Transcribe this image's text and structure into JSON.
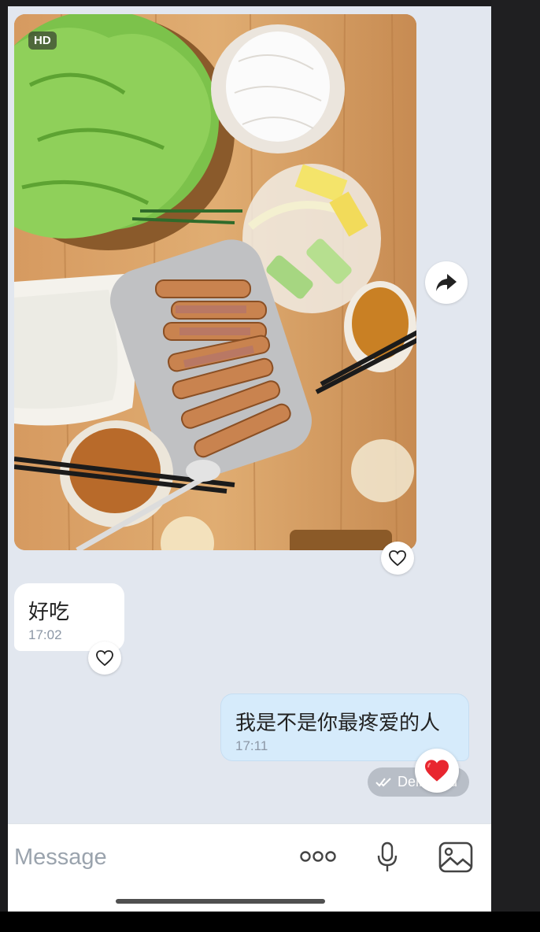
{
  "photo": {
    "badge": "HD",
    "liked": false
  },
  "messages": [
    {
      "direction": "incoming",
      "text": "好吃",
      "time": "17:02",
      "liked": false
    },
    {
      "direction": "outgoing",
      "text": "我是不是你最疼爱的人",
      "time": "17:11",
      "reaction": "heart",
      "status": "Delivered"
    }
  ],
  "composer": {
    "placeholder": "Message",
    "icons": [
      "more-icon",
      "microphone-icon",
      "image-icon"
    ]
  },
  "colors": {
    "background": "#e2e7ef",
    "outgoing_bubble": "#d6ebfb",
    "incoming_bubble": "#ffffff",
    "reaction": "#e8262f"
  }
}
